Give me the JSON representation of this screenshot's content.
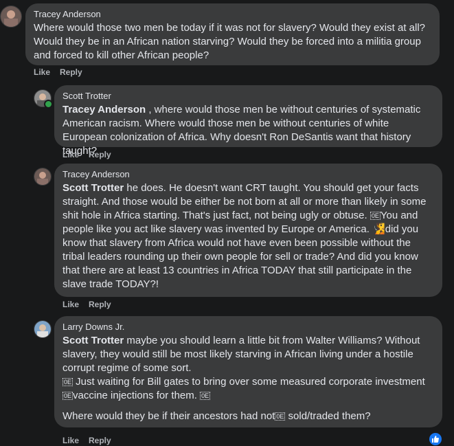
{
  "comments": [
    {
      "author": "Tracey Anderson",
      "text": "Where would those two men be today if it was not for slavery? Would they exist at all? Would they be in an African nation starving? Would they be forced into a militia group and forced to kill other African people?",
      "like": "Like",
      "reply": "Reply"
    },
    {
      "author": "Scott Trotter",
      "mention": "Tracey Anderson",
      "text": " , where would those men be without centuries of systematic American racism. Where would those men be without centuries of white European colonization of Africa. Why doesn't Ron DeSantis want that history taught?",
      "like": "Like",
      "reply": "Reply"
    },
    {
      "author": "Tracey Anderson",
      "mention": "Scott Trotter",
      "text_a": " he does. He doesn't want CRT taught. You should get your facts straight. And those would be either be not born at all or more than likely in some shit hole in Africa starting. That's just fact, not being ugly or obtuse. ",
      "box1": "0E",
      "text_b": "You and people like you act like slavery was invented by Europe or America. ",
      "emoji": "🧏",
      "text_c": "did you know that slavery from Africa would not have even been possible without the tribal leaders rounding up their own people for sell or trade? And did you know that there are at least 13 countries in Africa TODAY that still participate in the slave trade TODAY?!",
      "like": "Like",
      "reply": "Reply"
    },
    {
      "author": "Larry Downs Jr.",
      "mention": "Scott Trotter",
      "text_a": " maybe you should learn a little bit from Walter Williams? Without slavery, they would still be most likely starving in African living under a hostile corrupt regime of some sort.",
      "box1": "0E",
      "text_b": " Just waiting for Bill gates to bring over some measured corporate investment ",
      "box2": "0E",
      "text_c": "vaccine injections for them. ",
      "box3": "0E",
      "text_d": "Where would they be if their ancestors had not",
      "box4": "0E",
      "text_e": " sold/traded them?",
      "like": "Like",
      "reply": "Reply"
    }
  ],
  "colors": {
    "background": "#18191a",
    "bubble": "#3a3b3c",
    "text": "#e4e6eb",
    "muted": "#b0b3b8",
    "online": "#31a24c",
    "like_blue": "#1877f2"
  },
  "icons": {
    "reaction": "thumbs-up-icon",
    "online": "online-status-icon"
  }
}
